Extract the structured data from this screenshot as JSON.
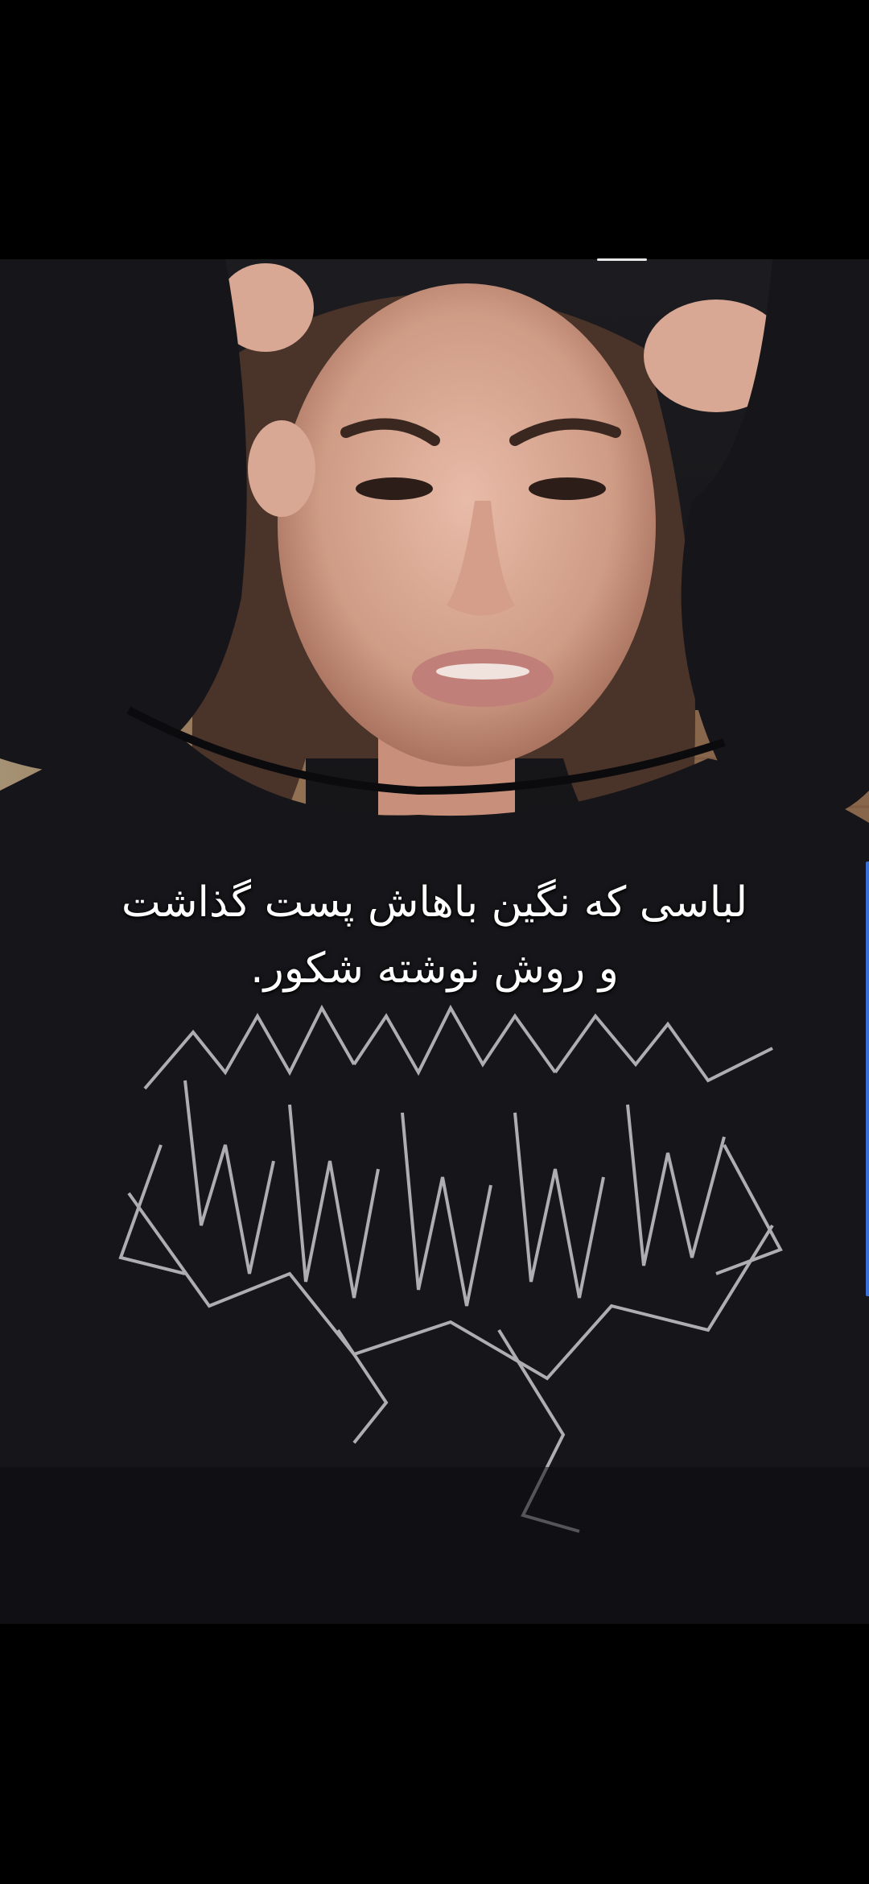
{
  "caption": {
    "line1": "لباسی که نگین باهاش پست گذاشت",
    "line2": "و روش نوشته شکور."
  },
  "colors": {
    "background": "#000000",
    "hoodie": "#16161a",
    "skin": "#d9a894",
    "hair": "#4a3328",
    "caption_text": "#ffffff",
    "progress": "#e8e8e8",
    "scroll_edge": "#3d6fd6"
  },
  "icons": {
    "graphic": "metal-band-logo-print"
  }
}
